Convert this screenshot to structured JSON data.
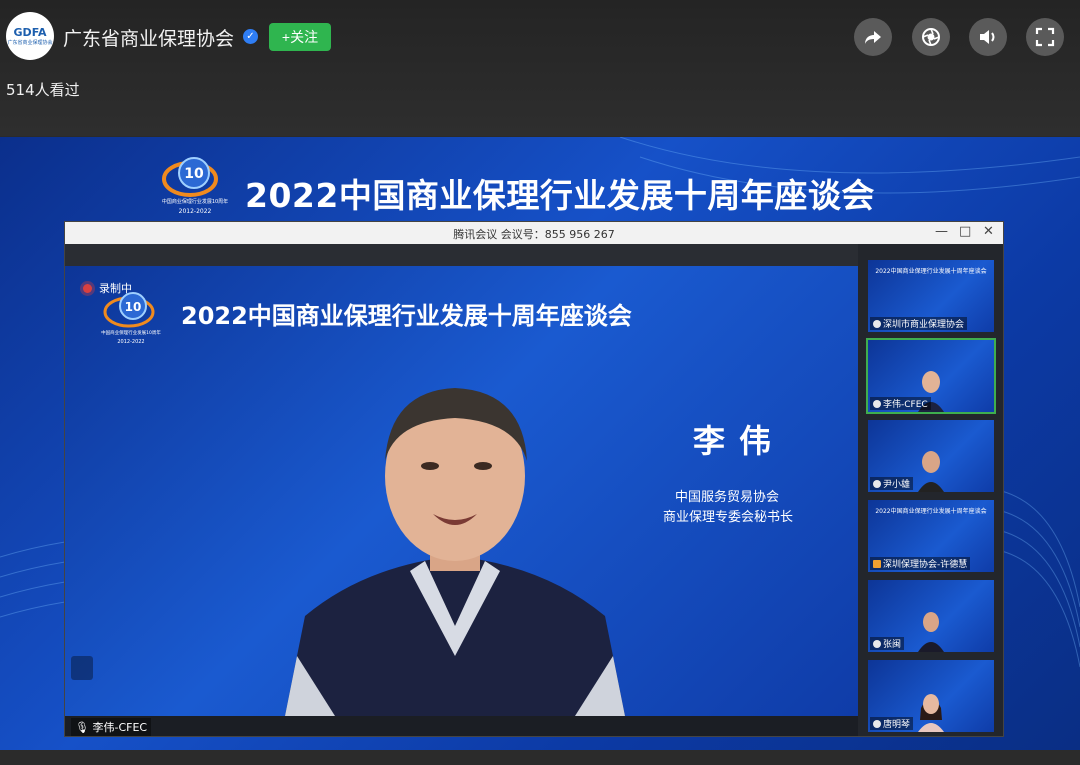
{
  "header": {
    "avatar_text": "GDFA",
    "avatar_subtext": "广东省商业保理协会",
    "channel_name": "广东省商业保理协会",
    "follow_label": "+关注",
    "views": "514人看过",
    "icons": [
      "share-icon",
      "camera-icon",
      "volume-icon",
      "fullscreen-icon"
    ]
  },
  "video": {
    "banner_logo_text": "10",
    "banner_logo_caption": "中国商业保理行业发展10周年",
    "banner_logo_years": "2012-2022",
    "banner_title": "2022中国商业保理行业发展十周年座谈会",
    "meeting": {
      "window_title": "腾讯会议 会议号：855 956 267",
      "recording_label": "录制中",
      "inner_title": "2022中国商业保理行业发展十周年座谈会",
      "speaker_name": "李伟",
      "speaker_org_line1": "中国服务贸易协会",
      "speaker_org_line2": "商业保理专委会秘书长",
      "main_participant": "李伟-CFEC",
      "participants": [
        {
          "name": "深圳市商业保理协会",
          "active": false
        },
        {
          "name": "李伟-CFEC",
          "active": true
        },
        {
          "name": "尹小雄",
          "active": false
        },
        {
          "name": "深圳保理协会-许德慧",
          "active": false
        },
        {
          "name": "张闽",
          "active": false
        },
        {
          "name": "唐明琴",
          "active": false
        }
      ]
    }
  },
  "colors": {
    "follow_green": "#2fb54f",
    "verified_blue": "#2f7ef5",
    "video_blue": "#1651c8"
  }
}
